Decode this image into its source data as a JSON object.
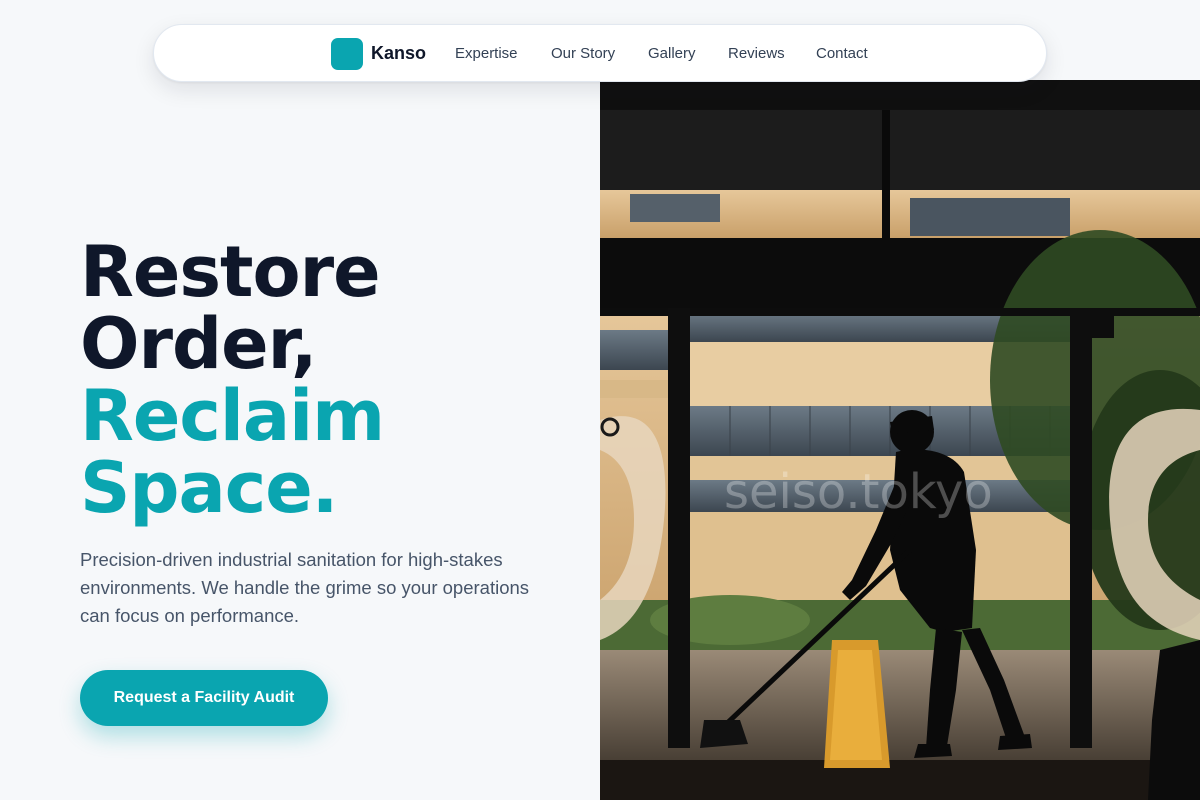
{
  "nav": {
    "brand": "Kanso",
    "links": [
      "Expertise",
      "Our Story",
      "Gallery",
      "Reviews",
      "Contact"
    ]
  },
  "hero": {
    "headline_line1": "Restore",
    "headline_line2": "Order,",
    "headline_line3": "Reclaim",
    "headline_line4": "Space.",
    "subtext": "Precision-driven industrial sanitation for high-stakes environments. We handle the grime so your operations can focus on performance.",
    "cta_label": "Request a Facility Audit",
    "image_watermark": "seiso.tokyo"
  },
  "colors": {
    "accent": "#0aa5b0",
    "heading": "#0f172a",
    "body": "#475569",
    "background": "#f6f8fa"
  }
}
